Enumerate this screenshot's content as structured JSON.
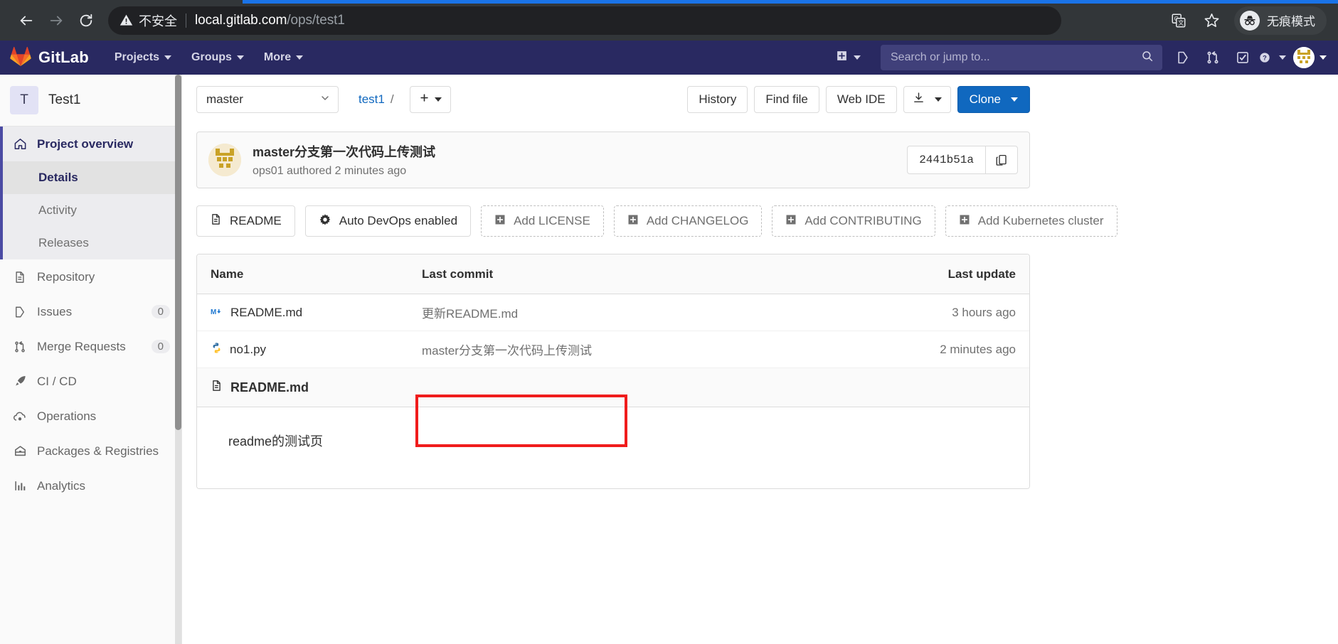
{
  "browser": {
    "back_icon": "arrow-left-icon",
    "forward_icon": "arrow-right-icon",
    "reload_icon": "reload-icon",
    "security_label": "不安全",
    "url_host": "local.gitlab.com",
    "url_path": "/ops/test1",
    "translate_icon": "translate-icon",
    "bookmark_icon": "star-icon",
    "incognito_label": "无痕模式"
  },
  "navbar": {
    "brand": "GitLab",
    "links": [
      {
        "label": "Projects"
      },
      {
        "label": "Groups"
      },
      {
        "label": "More"
      }
    ],
    "new_icon": "plus-square-icon",
    "search_placeholder": "Search or jump to...",
    "search_value": "",
    "search_icon": "search-icon",
    "icons": [
      {
        "name": "issues-icon"
      },
      {
        "name": "merge-requests-icon"
      },
      {
        "name": "todos-icon"
      },
      {
        "name": "help-icon"
      }
    ],
    "avatar_name": "user-avatar"
  },
  "sidebar": {
    "project_initial": "T",
    "project_name": "Test1",
    "items": [
      {
        "label": "Project overview",
        "icon": "home-icon",
        "active": true,
        "children": [
          {
            "label": "Details",
            "current": true
          },
          {
            "label": "Activity",
            "current": false
          },
          {
            "label": "Releases",
            "current": false
          }
        ]
      },
      {
        "label": "Repository",
        "icon": "document-icon",
        "badge": ""
      },
      {
        "label": "Issues",
        "icon": "issues-icon",
        "badge": "0"
      },
      {
        "label": "Merge Requests",
        "icon": "merge-requests-icon",
        "badge": "0"
      },
      {
        "label": "CI / CD",
        "icon": "rocket-icon",
        "badge": ""
      },
      {
        "label": "Operations",
        "icon": "cloud-gear-icon",
        "badge": ""
      },
      {
        "label": "Packages & Registries",
        "icon": "package-icon",
        "badge": ""
      },
      {
        "label": "Analytics",
        "icon": "chart-bar-icon",
        "badge": ""
      }
    ]
  },
  "repo_toolbar": {
    "branch": "master",
    "breadcrumb_project": "test1",
    "breadcrumb_sep": "/",
    "add_icon": "plus-icon",
    "history_label": "History",
    "find_file_label": "Find file",
    "web_ide_label": "Web IDE",
    "download_icon": "download-icon",
    "clone_label": "Clone"
  },
  "commit": {
    "title": "master分支第一次代码上传测试",
    "author": "ops01",
    "meta_suffix": "authored 2 minutes ago",
    "sha": "2441b51a",
    "copy_icon": "clipboard-icon",
    "avatar_name": "commit-author-avatar"
  },
  "quick_actions": [
    {
      "label": "README",
      "icon": "document-icon",
      "dashed": false
    },
    {
      "label": "Auto DevOps enabled",
      "icon": "gear-icon",
      "dashed": false
    },
    {
      "label": "Add LICENSE",
      "icon": "plus-square-icon",
      "dashed": true
    },
    {
      "label": "Add CHANGELOG",
      "icon": "plus-square-icon",
      "dashed": true
    },
    {
      "label": "Add CONTRIBUTING",
      "icon": "plus-square-icon",
      "dashed": true
    },
    {
      "label": "Add Kubernetes cluster",
      "icon": "plus-square-icon",
      "dashed": true
    }
  ],
  "file_table": {
    "headers": {
      "name": "Name",
      "last_commit": "Last commit",
      "last_update": "Last update"
    },
    "rows": [
      {
        "name": "README.md",
        "icon": "markdown-file-icon",
        "last_commit": "更新README.md",
        "last_update": "3 hours ago"
      },
      {
        "name": "no1.py",
        "icon": "python-file-icon",
        "last_commit": "master分支第一次代码上传测试",
        "last_update": "2 minutes ago"
      }
    ]
  },
  "readme_preview": {
    "icon": "document-icon",
    "title": "README.md",
    "content": "readme的测试页"
  },
  "colors": {
    "gitlab_purple": "#292961",
    "link_blue": "#1068bf",
    "primary_button": "#1068bf",
    "highlight_red": "#f01c1c",
    "chrome_dark": "#323639"
  }
}
